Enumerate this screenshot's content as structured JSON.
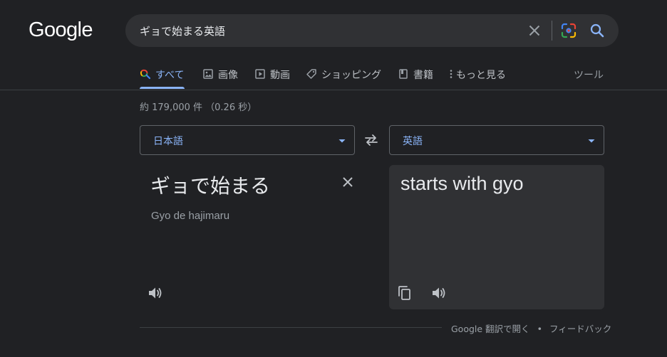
{
  "logo": {
    "text": "Google"
  },
  "search": {
    "query": "ギョで始まる英語"
  },
  "tabs": [
    {
      "label": "すべて",
      "icon": "search-icon",
      "active": true
    },
    {
      "label": "画像",
      "icon": "image-icon",
      "active": false
    },
    {
      "label": "動画",
      "icon": "video-icon",
      "active": false
    },
    {
      "label": "ショッピング",
      "icon": "tag-icon",
      "active": false
    },
    {
      "label": "書籍",
      "icon": "book-icon",
      "active": false
    },
    {
      "label": "もっと見る",
      "icon": "more-vert-icon",
      "active": false
    }
  ],
  "tools_label": "ツール",
  "result_stats": "約 179,000 件 （0.26 秒）",
  "translator": {
    "source_lang": "日本語",
    "target_lang": "英語",
    "source_text": "ギョで始まる",
    "source_transliteration": "Gyo de hajimaru",
    "target_text": "starts with gyo"
  },
  "footer": {
    "open_translate": "Google 翻訳で開く",
    "separator": "•",
    "feedback": "フィードバック"
  },
  "colors": {
    "background": "#202124",
    "panel": "#303134",
    "accent": "#8ab4f8",
    "text": "#e8eaed",
    "muted": "#9aa0a6"
  }
}
